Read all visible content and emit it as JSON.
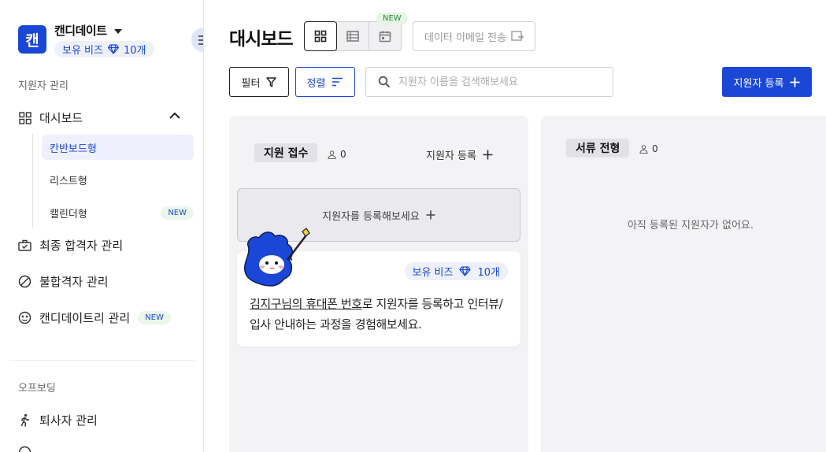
{
  "sidebar": {
    "logo_char": "캔",
    "org_name": "캔디데이트",
    "biz_label": "보유 비즈",
    "biz_count": "10개",
    "section_recruit": "지원자 관리",
    "dashboard_label": "대시보드",
    "sub_items": [
      {
        "label": "칸반보드형"
      },
      {
        "label": "리스트형"
      },
      {
        "label": "캘린더형",
        "badge": "NEW"
      }
    ],
    "items": [
      {
        "label": "최종 합격자 관리"
      },
      {
        "label": "불합격자 관리"
      },
      {
        "label": "캔디데이트리 관리",
        "badge": "NEW"
      }
    ],
    "section_offboarding": "오프보딩",
    "offboarding_items": [
      {
        "label": "퇴사자 관리"
      }
    ]
  },
  "header": {
    "title": "대시보드",
    "new_tag": "NEW",
    "email_button": "데이터 이메일 전송"
  },
  "toolbar": {
    "filter_label": "필터",
    "sort_label": "정렬",
    "search_placeholder": "지원자 이름을 검색해보세요",
    "register_label": "지원자 등록"
  },
  "columns": [
    {
      "title": "지원 접수",
      "count": "0",
      "add_label": "지원자 등록",
      "register_prompt": "지원자를 등록해보세요",
      "card": {
        "pill_label": "보유 비즈",
        "pill_count": "10개",
        "link_text": "김지구님의 휴대폰 번호",
        "body_text": "로 지원자를 등록하고 인터뷰/입사 안내하는 과정을 경험해보세요."
      }
    },
    {
      "title": "서류 전형",
      "count": "0",
      "empty_text": "아직 등록된 지원자가 없어요."
    }
  ],
  "colors": {
    "primary": "#1a47d6",
    "pill_bg": "#eef1fc",
    "column_bg": "#f3f3f6",
    "mascot": "#1a47d6"
  }
}
